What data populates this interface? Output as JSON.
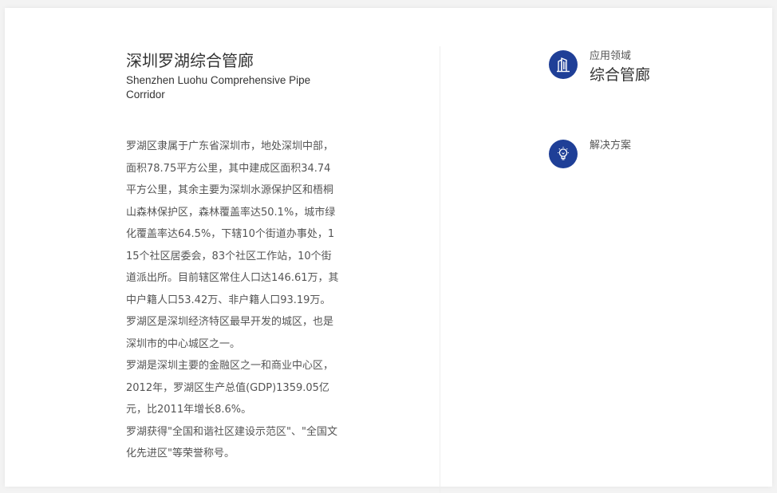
{
  "project": {
    "title_cn": "深圳罗湖综合管廊",
    "title_en": "Shenzhen Luohu Comprehensive Pipe Corridor",
    "description": [
      "罗湖区隶属于广东省深圳市，地处深圳中部，面积78.75平方公里，其中建成区面积34.74平方公里，其余主要为深圳水源保护区和梧桐山森林保护区，森林覆盖率达50.1%，城市绿化覆盖率达64.5%，下辖10个街道办事处，115个社区居委会，83个社区工作站，10个街道派出所。目前辖区常住人口达146.61万，其中户籍人口53.42万、非户籍人口93.19万。罗湖区是深圳经济特区最早开发的城区，也是深圳市的中心城区之一。",
      "罗湖是深圳主要的金融区之一和商业中心区，2012年，罗湖区生产总值(GDP)1359.05亿元，比2011年增长8.6%。",
      "罗湖获得\"全国和谐社区建设示范区\"、\"全国文化先进区\"等荣誉称号。"
    ]
  },
  "sidebar": {
    "field": {
      "label": "应用领域",
      "value": "综合管廊",
      "icon": "building-icon"
    },
    "solution": {
      "label": "解决方案",
      "value": "",
      "icon": "lightbulb-icon"
    }
  },
  "colors": {
    "accent": "#1f3f97",
    "title_text": "#333333",
    "body_text": "#555555",
    "divider": "#eeeeee"
  }
}
